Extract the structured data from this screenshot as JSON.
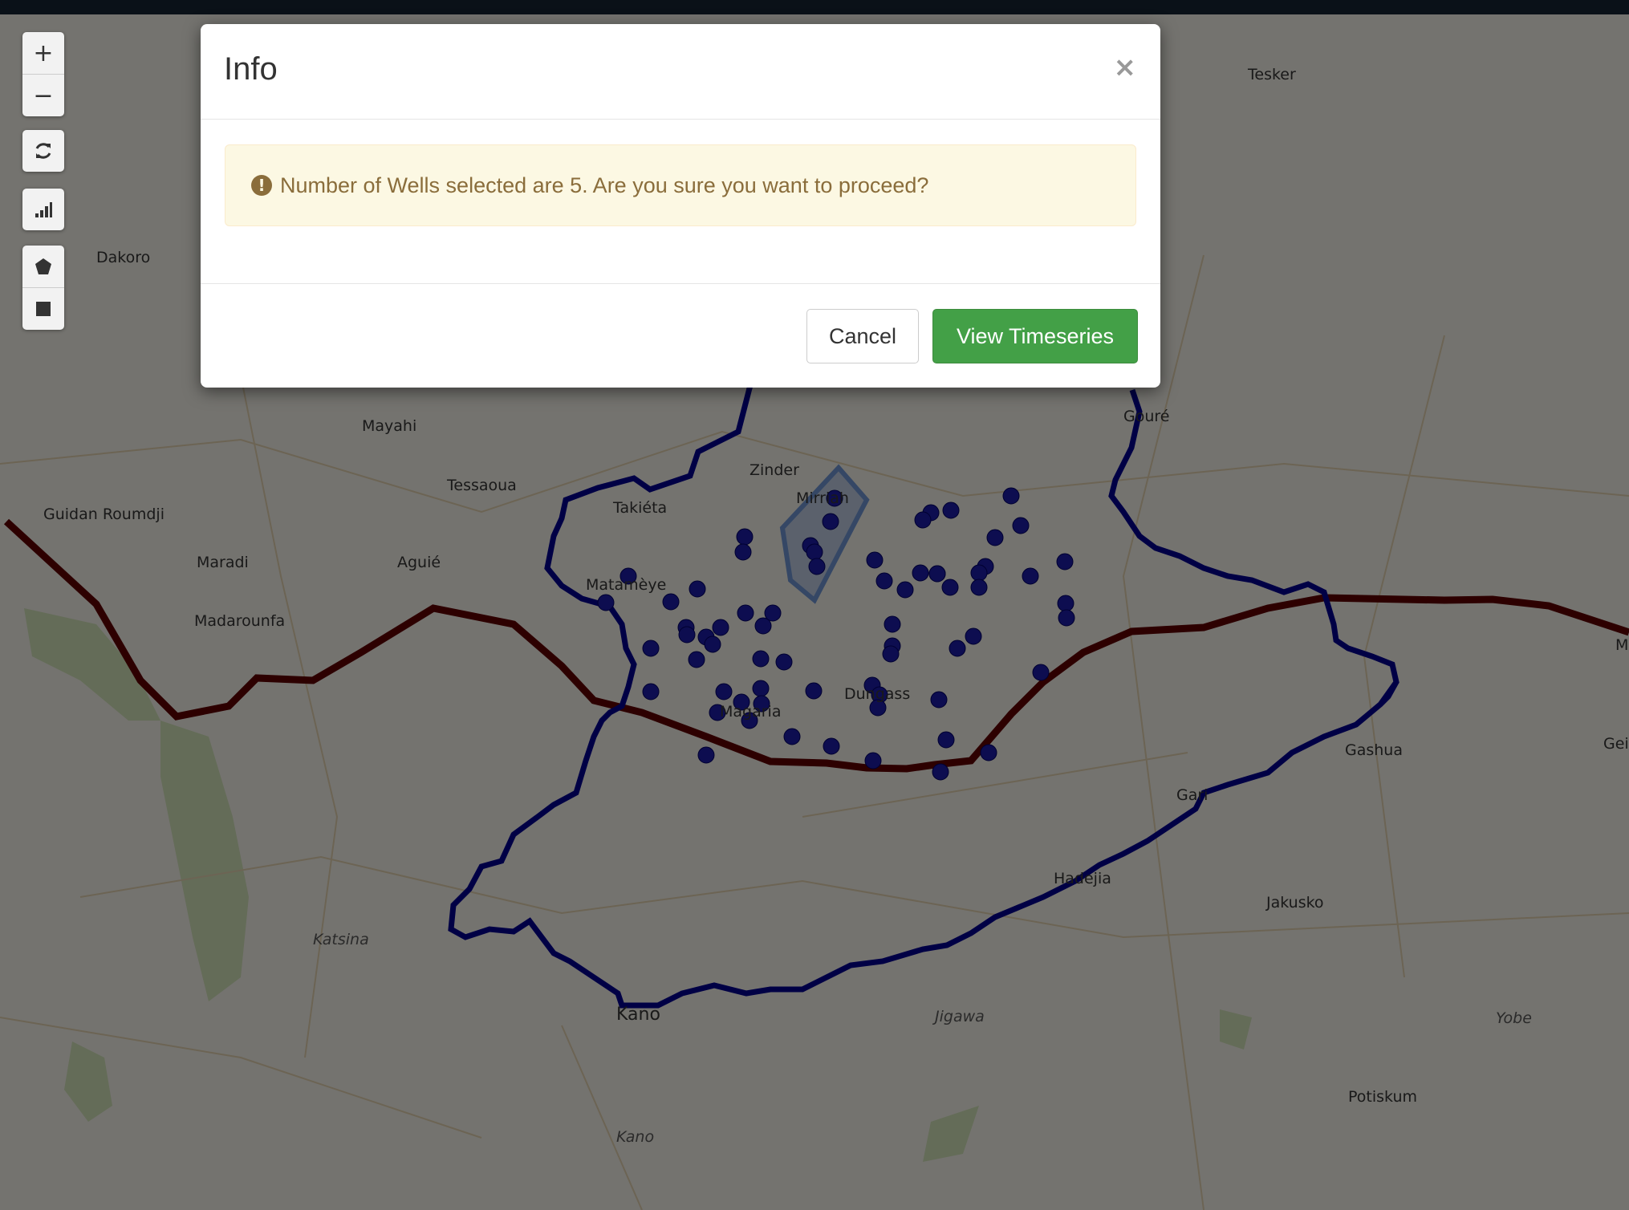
{
  "modal": {
    "title": "Info",
    "close_label": "×",
    "alert_icon": "!",
    "message": "Number of Wells selected are 5. Are you sure you want to proceed?",
    "cancel_label": "Cancel",
    "confirm_label": "View Timeseries"
  },
  "map_controls": {
    "zoom_in": "+",
    "zoom_out": "−",
    "refresh_icon": "refresh-icon",
    "chart_icon": "bar-chart-icon",
    "polygon_icon": "polygon-draw-icon",
    "rectangle_icon": "rectangle-draw-icon"
  },
  "places": {
    "tesker": "Tesker",
    "dakoro": "Dakoro",
    "mayahi": "Mayahi",
    "goure": "Gouré",
    "tessaoua": "Tessaoua",
    "zinder": "Zinder",
    "guidan": "Guidan Roumdji",
    "takieta": "Takiéta",
    "mirriah": "Mirriah",
    "maradi": "Maradi",
    "aguie": "Aguié",
    "matameye": "Matamèye",
    "madarounfa": "Madarounfa",
    "dungass": "Dungass",
    "magaria": "Magaria",
    "gashua": "Gashua",
    "gei": "Gei",
    "gari": "Gari",
    "hadejia": "Hadejia",
    "katsina": "Katsina",
    "jakusko": "Jakusko",
    "kano_city": "Kano",
    "jigawa": "Jigawa",
    "yobe": "Yobe",
    "potiskum": "Potiskum",
    "kano_state": "Kano",
    "m_edge": "M"
  },
  "colors": {
    "basin_outline": "#00008b",
    "border_line": "#5a0000",
    "well_points": "#1a1aa0",
    "selection_polygon": "#4a6fa5",
    "confirm_button": "#43a047",
    "alert_text": "#8a6d3b"
  }
}
